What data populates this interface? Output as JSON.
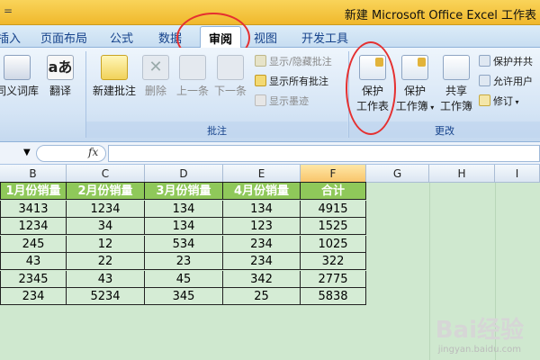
{
  "title": "新建 Microsoft Office Excel 工作表",
  "quick_access": "=",
  "tabs": [
    "插入",
    "页面布局",
    "公式",
    "数据",
    "审阅",
    "视图",
    "开发工具"
  ],
  "active_tab": "审阅",
  "ribbon": {
    "thesaurus": "同义词库",
    "translate": "翻译",
    "new_comment": "新建批注",
    "delete": "删除",
    "previous": "上一条",
    "next": "下一条",
    "show_hide_comment": "显示/隐藏批注",
    "show_all_comments": "显示所有批注",
    "show_ink": "显示墨迹",
    "comments_group": "批注",
    "protect_sheet_line1": "保护",
    "protect_sheet_line2": "工作表",
    "protect_workbook_line1": "保护",
    "protect_workbook_line2": "工作簿",
    "share_workbook_line1": "共享",
    "share_workbook_line2": "工作簿",
    "protect_and_share": "保护并共",
    "allow_users": "允许用户",
    "track_changes": "修订",
    "changes_group": "更改"
  },
  "formula_bar": {
    "fx": "fx",
    "value": ""
  },
  "columns": [
    "B",
    "C",
    "D",
    "E",
    "F",
    "G",
    "H",
    "I"
  ],
  "sheet": {
    "headers": [
      "1月份销量",
      "2月份销量",
      "3月份销量",
      "4月份销量",
      "合计"
    ],
    "rows": [
      [
        "3413",
        "1234",
        "134",
        "134",
        "4915"
      ],
      [
        "1234",
        "34",
        "134",
        "123",
        "1525"
      ],
      [
        "245",
        "12",
        "534",
        "234",
        "1025"
      ],
      [
        "43",
        "22",
        "23",
        "234",
        "322"
      ],
      [
        "2345",
        "43",
        "45",
        "342",
        "2775"
      ],
      [
        "234",
        "5234",
        "345",
        "25",
        "5838"
      ]
    ]
  },
  "watermark": {
    "logo": "Bai经验",
    "url": "jingyan.baidu.com"
  },
  "colors": {
    "header_fill": "#8fc85a",
    "cell_fill": "#d5ecd5",
    "highlight": "#e53030"
  }
}
